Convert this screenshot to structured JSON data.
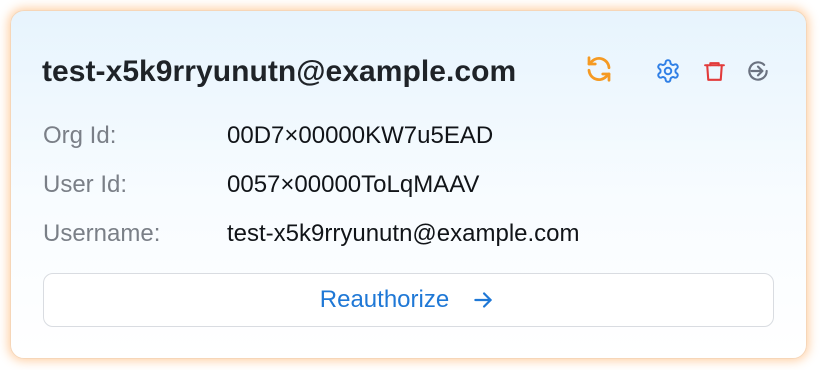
{
  "account": {
    "email": "test-x5k9rryunutn@example.com"
  },
  "fields": [
    {
      "label": "Org Id:",
      "value": "00D7×00000KW7u5EAD"
    },
    {
      "label": "User Id:",
      "value": "0057×00000ToLqMAAV"
    },
    {
      "label": "Username:",
      "value": "test-x5k9rryunutn@example.com"
    }
  ],
  "actions": {
    "reauthorize_label": "Reauthorize"
  },
  "icons": {
    "refresh": "refresh-icon",
    "settings": "gear-icon",
    "delete": "trash-icon",
    "signout": "sign-in-icon",
    "arrow": "arrow-right-icon"
  },
  "colors": {
    "refresh": "#f59a23",
    "settings": "#2f7fe6",
    "delete": "#e23b3b",
    "signout": "#6b7280",
    "reauthorize": "#1f78d6",
    "card_glow": "#ff9637"
  }
}
